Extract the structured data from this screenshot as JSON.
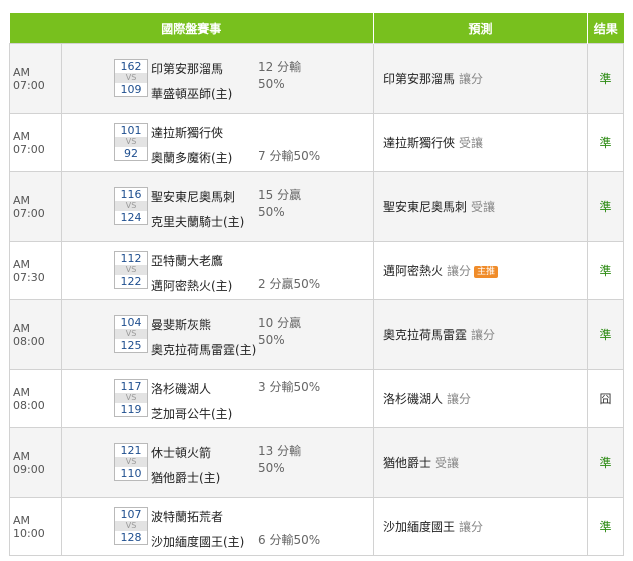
{
  "headers": {
    "match": "國際盤賽事",
    "prediction": "預測",
    "result": "结果"
  },
  "rows": [
    {
      "time": "AM 07:00",
      "away_score": "162",
      "vs": "VS",
      "home_score": "109",
      "away_team": "印第安那溜馬",
      "home_team": "華盛頓巫師(主)",
      "odds_line1": "12 分輸",
      "odds_line2": "50%",
      "pred_team": "印第安那溜馬",
      "pred_bet": "讓分",
      "badge": "",
      "result": "準",
      "result_status": "win"
    },
    {
      "time": "AM 07:00",
      "away_score": "101",
      "vs": "VS",
      "home_score": "92",
      "away_team": "達拉斯獨行俠",
      "home_team": "奧蘭多魔術(主)",
      "odds_line1": "",
      "odds_line2": "7 分輸50%",
      "pred_team": "達拉斯獨行俠",
      "pred_bet": "受讓",
      "badge": "",
      "result": "準",
      "result_status": "win"
    },
    {
      "time": "AM 07:00",
      "away_score": "116",
      "vs": "VS",
      "home_score": "124",
      "away_team": "聖安東尼奧馬刺",
      "home_team": "克里夫蘭騎士(主)",
      "odds_line1": "15 分贏",
      "odds_line2": "50%",
      "pred_team": "聖安東尼奧馬刺",
      "pred_bet": "受讓",
      "badge": "",
      "result": "準",
      "result_status": "win"
    },
    {
      "time": "AM 07:30",
      "away_score": "112",
      "vs": "VS",
      "home_score": "122",
      "away_team": "亞特蘭大老鷹",
      "home_team": "邁阿密熱火(主)",
      "odds_line1": "",
      "odds_line2": "2 分贏50%",
      "pred_team": "邁阿密熱火",
      "pred_bet": "讓分",
      "badge": "主推",
      "result": "準",
      "result_status": "win"
    },
    {
      "time": "AM 08:00",
      "away_score": "104",
      "vs": "VS",
      "home_score": "125",
      "away_team": "曼斐斯灰熊",
      "home_team": "奧克拉荷馬雷霆(主)",
      "odds_line1": "10 分贏",
      "odds_line2": "50%",
      "pred_team": "奧克拉荷馬雷霆",
      "pred_bet": "讓分",
      "badge": "",
      "result": "準",
      "result_status": "win"
    },
    {
      "time": "AM 08:00",
      "away_score": "117",
      "vs": "VS",
      "home_score": "119",
      "away_team": "洛杉磯湖人",
      "home_team": "芝加哥公牛(主)",
      "odds_line1": "3 分輸50%",
      "odds_line2": "",
      "pred_team": "洛杉磯湖人",
      "pred_bet": "讓分",
      "badge": "",
      "result": "囧",
      "result_status": "lose"
    },
    {
      "time": "AM 09:00",
      "away_score": "121",
      "vs": "VS",
      "home_score": "110",
      "away_team": "休士頓火箭",
      "home_team": "猶他爵士(主)",
      "odds_line1": "13 分輸",
      "odds_line2": "50%",
      "pred_team": "猶他爵士",
      "pred_bet": "受讓",
      "badge": "",
      "result": "準",
      "result_status": "win"
    },
    {
      "time": "AM 10:00",
      "away_score": "107",
      "vs": "VS",
      "home_score": "128",
      "away_team": "波特蘭拓荒者",
      "home_team": "沙加緬度國王(主)",
      "odds_line1": "",
      "odds_line2": "6 分輸50%",
      "pred_team": "沙加緬度國王",
      "pred_bet": "讓分",
      "badge": "",
      "result": "準",
      "result_status": "win"
    }
  ]
}
